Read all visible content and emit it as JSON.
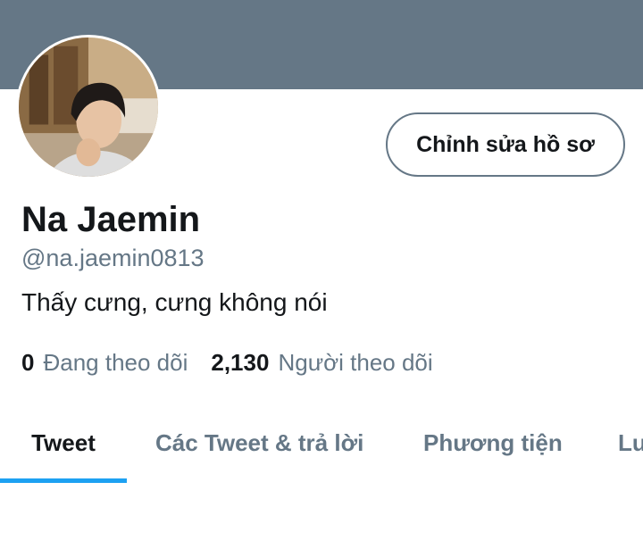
{
  "profile": {
    "display_name": "Na Jaemin",
    "handle": "@na.jaemin0813",
    "bio": "Thấy cưng, cưng không nói",
    "edit_button_label": "Chỉnh sửa hồ sơ"
  },
  "stats": {
    "following_count": "0",
    "following_label": "Đang theo dõi",
    "followers_count": "2,130",
    "followers_label": "Người theo dõi"
  },
  "tabs": [
    {
      "label": "Tweet",
      "active": true
    },
    {
      "label": "Các Tweet & trả lời",
      "active": false
    },
    {
      "label": "Phương tiện",
      "active": false
    },
    {
      "label": "Lu",
      "active": false
    }
  ],
  "colors": {
    "banner": "#657786",
    "accent": "#1da1f2",
    "text_primary": "#14171a",
    "text_secondary": "#657786"
  }
}
